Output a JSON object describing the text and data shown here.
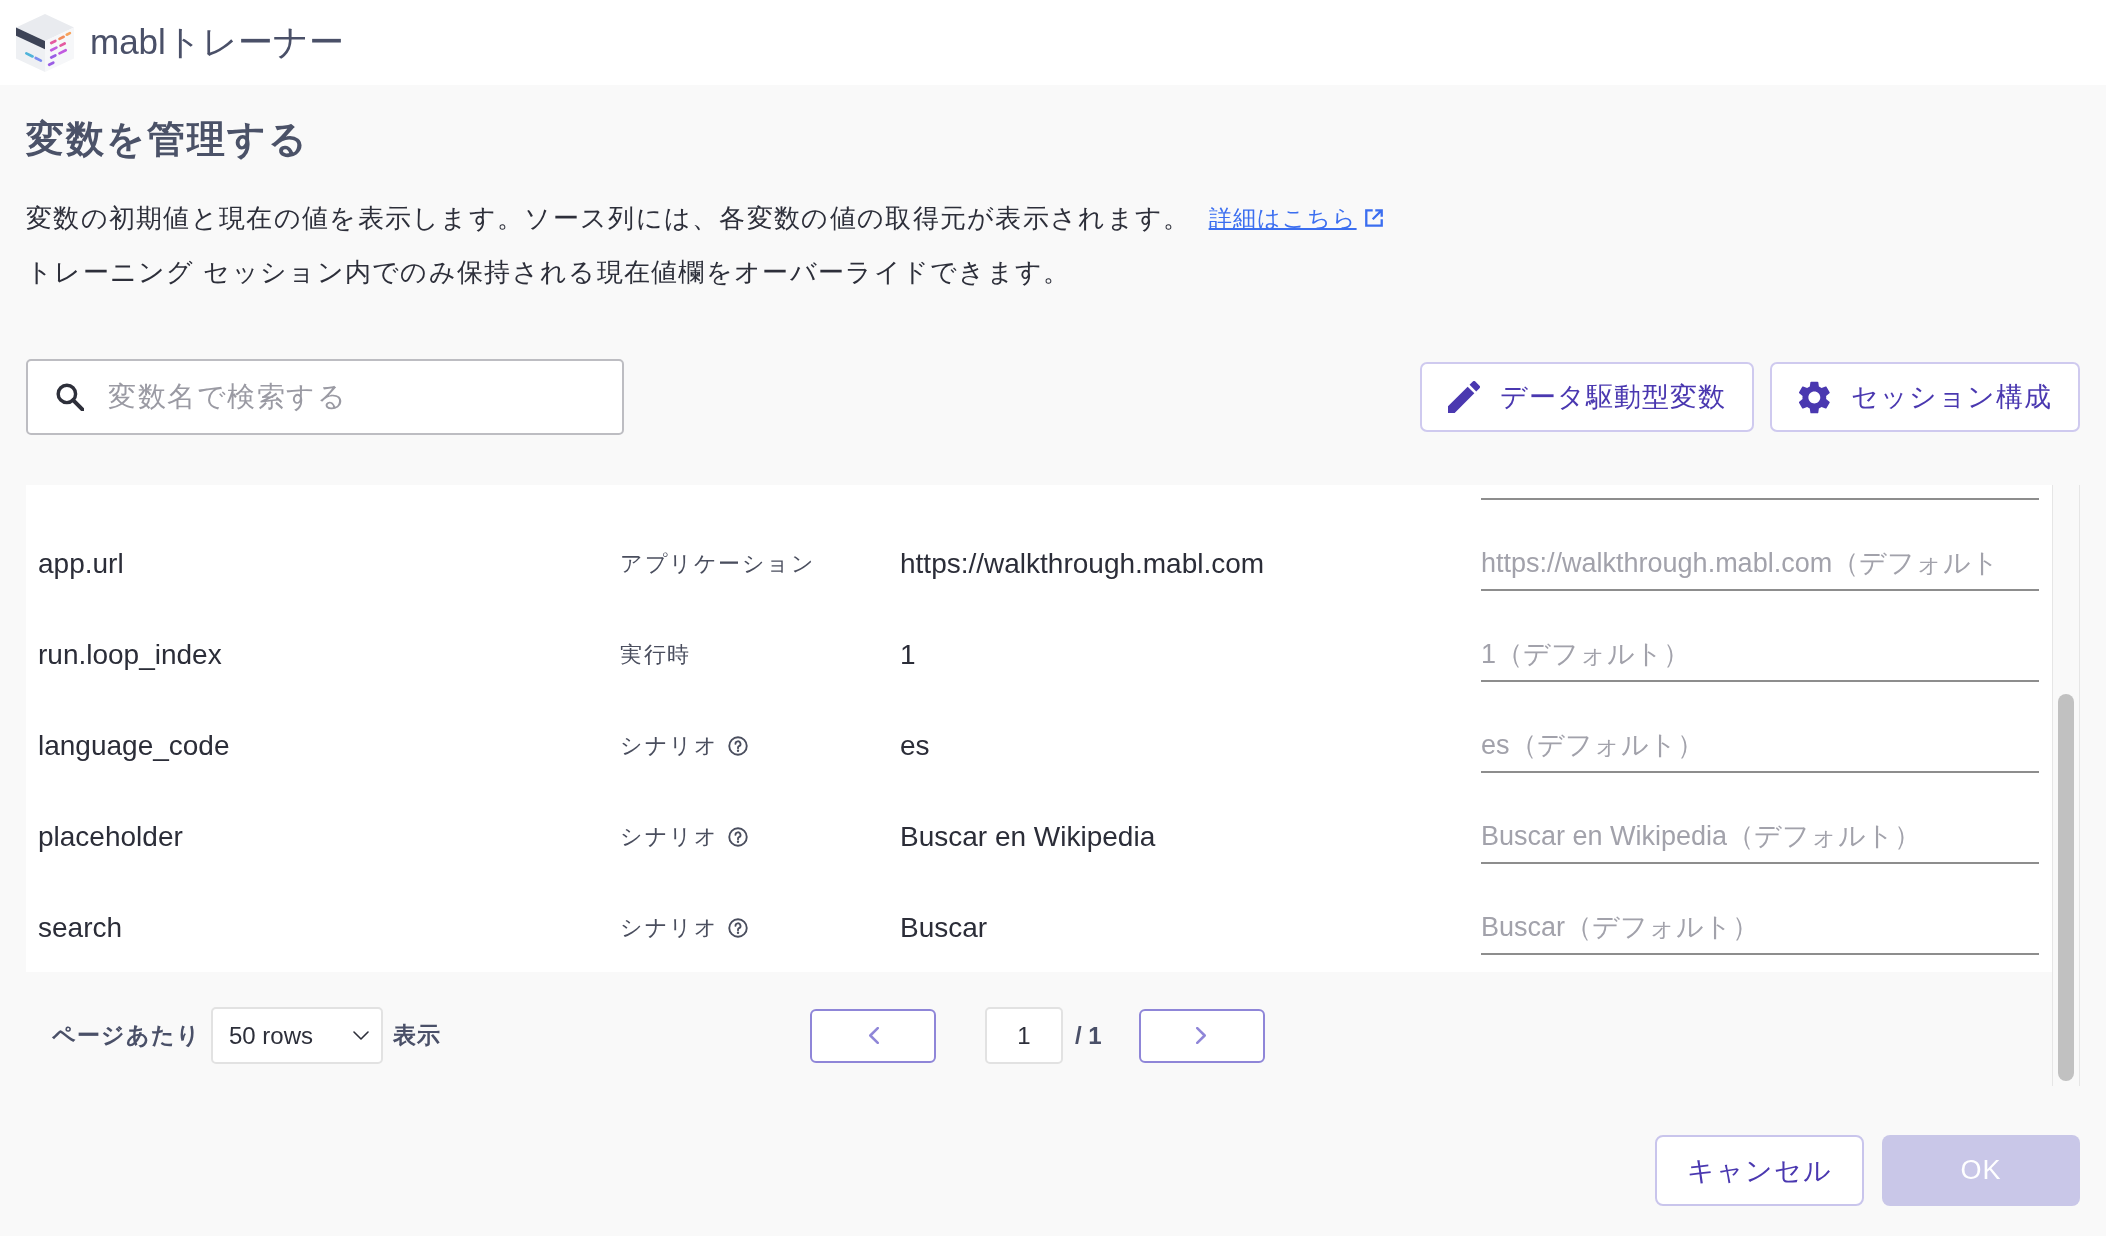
{
  "header": {
    "app_name": "mablトレーナー"
  },
  "page": {
    "title": "変数を管理する",
    "description": [
      {
        "text": "変数の初期値と現在の値を表示します。ソース列には、各変数の値の取得元が表示されます。",
        "link": "詳細はこちら"
      },
      {
        "text": "トレーニング セッション内でのみ保持される現在値欄をオーバーライドできます。"
      }
    ]
  },
  "search": {
    "placeholder": "変数名で検索する"
  },
  "toolbar_buttons": [
    {
      "kind": "edit",
      "label": "データ駆動型変数"
    },
    {
      "kind": "settings",
      "label": "セッション構成"
    }
  ],
  "table": {
    "rows": [
      {
        "name": "app.url",
        "source": "アプリケーション",
        "source_help": false,
        "value": "https://walkthrough.mabl.com",
        "current_placeholder": "https://walkthrough.mabl.com（デフォルト"
      },
      {
        "name": "run.loop_index",
        "source": "実行時",
        "source_help": false,
        "value": "1",
        "current_placeholder": "1（デフォルト）"
      },
      {
        "name": "language_code",
        "source": "シナリオ",
        "source_help": true,
        "value": "es",
        "current_placeholder": "es（デフォルト）"
      },
      {
        "name": "placeholder",
        "source": "シナリオ",
        "source_help": true,
        "value": "Buscar en Wikipedia",
        "current_placeholder": "Buscar en Wikipedia（デフォルト）"
      },
      {
        "name": "search",
        "source": "シナリオ",
        "source_help": true,
        "value": "Buscar",
        "current_placeholder": "Buscar（デフォルト）"
      }
    ]
  },
  "pagination": {
    "per_page_label": "ページあたり",
    "rows_per_page": "50 rows",
    "show_label": "表示",
    "page": "1",
    "total": "/ 1"
  },
  "footer_buttons": [
    {
      "kind": "secondary",
      "label": "キャンセル",
      "disabled": false
    },
    {
      "kind": "primary",
      "label": "OK",
      "disabled": true
    }
  ]
}
